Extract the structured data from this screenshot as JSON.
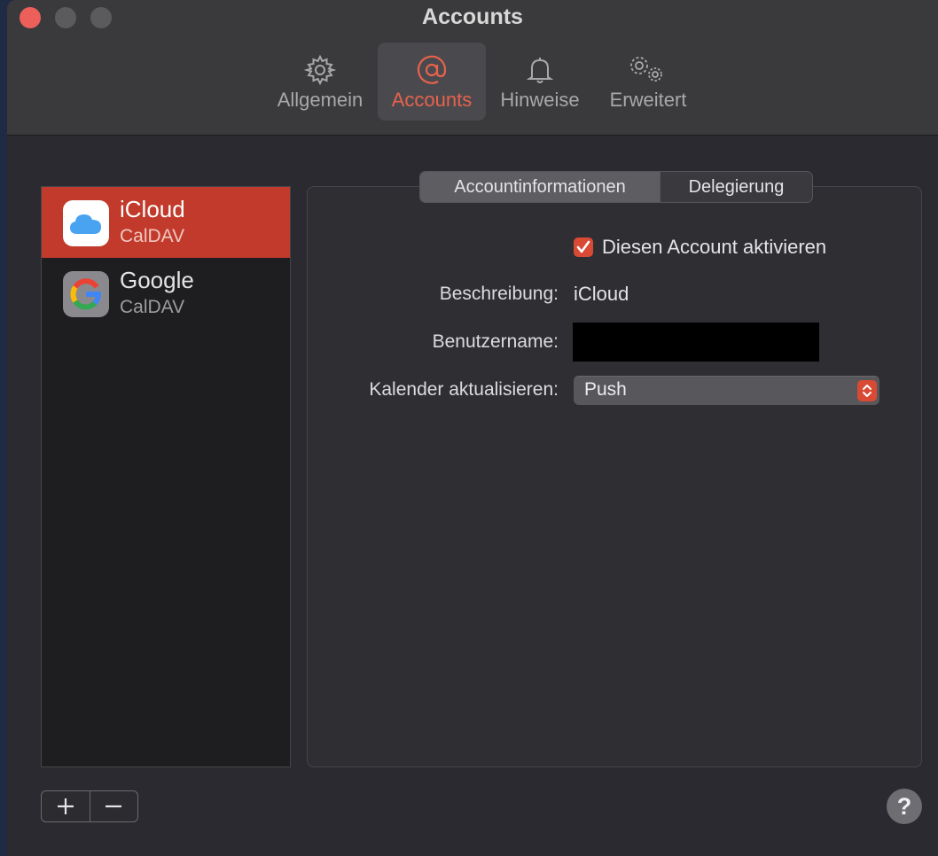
{
  "window": {
    "title": "Accounts"
  },
  "toolbar": {
    "items": [
      {
        "label": "Allgemein",
        "icon": "gear-icon",
        "active": false
      },
      {
        "label": "Accounts",
        "icon": "at-sign-icon",
        "active": true
      },
      {
        "label": "Hinweise",
        "icon": "bell-icon",
        "active": false
      },
      {
        "label": "Erweitert",
        "icon": "gears-icon",
        "active": false
      }
    ]
  },
  "accounts": [
    {
      "name": "iCloud",
      "type": "CalDAV",
      "icon": "icloud-icon",
      "selected": true
    },
    {
      "name": "Google",
      "type": "CalDAV",
      "icon": "google-icon",
      "selected": false
    }
  ],
  "tabs": [
    {
      "label": "Accountinformationen",
      "active": true
    },
    {
      "label": "Delegierung",
      "active": false
    }
  ],
  "form": {
    "enable_label": "Diesen Account aktivieren",
    "enable_checked": true,
    "description_label": "Beschreibung:",
    "description_value": "iCloud",
    "username_label": "Benutzername:",
    "refresh_label": "Kalender aktualisieren:",
    "refresh_value": "Push"
  },
  "footer": {
    "add": "+",
    "remove": "−",
    "help": "?"
  },
  "colors": {
    "accent": "#d94a35",
    "selection": "#c13a2b"
  }
}
